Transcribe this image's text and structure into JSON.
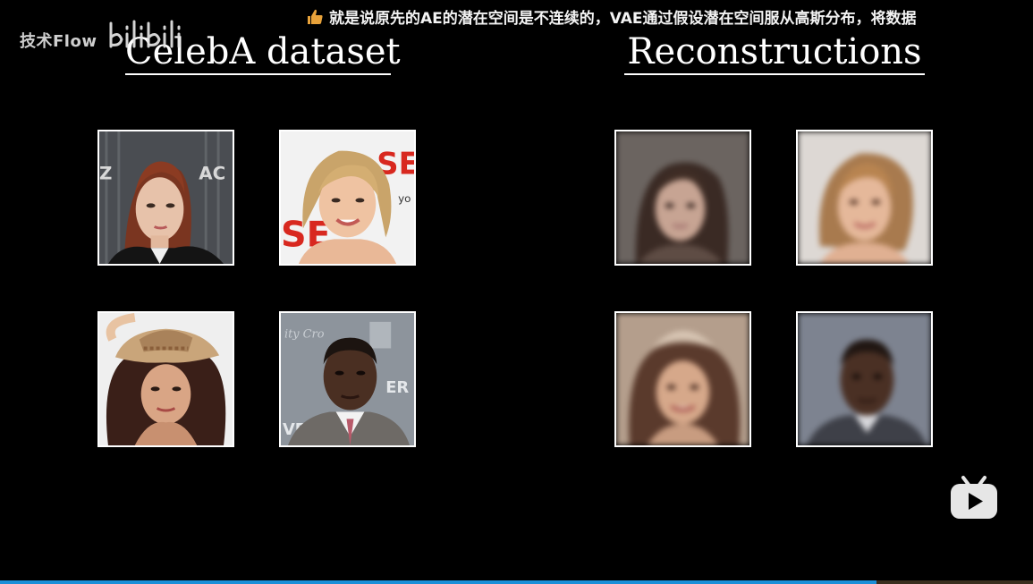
{
  "watermark": {
    "channel_name": "技术Flow",
    "logo_name": "bilibili-logo"
  },
  "danmaku": {
    "icon": "thumbs-up-icon",
    "text": "就是说原先的AE的潜在空间是不连续的，VAE通过假设潜在空间服从高斯分布，将数据"
  },
  "slide": {
    "left_title": "CelebA dataset",
    "right_title": "Reconstructions"
  },
  "player": {
    "play_icon": "bilibili-play-icon",
    "progress_color": "#1a8fd8"
  }
}
